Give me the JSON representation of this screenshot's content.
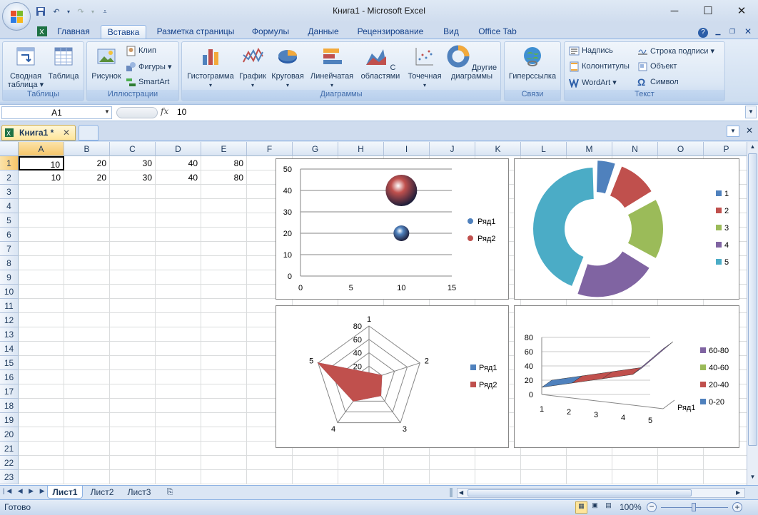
{
  "app": {
    "title": "Книга1 - Microsoft Excel"
  },
  "window_controls": {
    "minimize": "─",
    "maximize": "☐",
    "close": "✕"
  },
  "tabs": [
    "Главная",
    "Вставка",
    "Разметка страницы",
    "Формулы",
    "Данные",
    "Рецензирование",
    "Вид",
    "Office Tab"
  ],
  "active_tab": "Вставка",
  "ribbon": {
    "groups": {
      "tables": "Таблицы",
      "illustrations": "Иллюстрации",
      "charts": "Диаграммы",
      "links": "Связи",
      "text": "Текст"
    },
    "pivot_table": "Сводная таблица ▾",
    "table": "Таблица",
    "picture": "Рисунок",
    "clip": "Клип",
    "shapes": "Фигуры ▾",
    "smartart": "SmartArt",
    "histogram": "Гистограмма",
    "line": "График",
    "pie": "Круговая",
    "bar": "Линейчатая",
    "area": "С областями",
    "scatter": "Точечная",
    "other": "Другие диаграммы",
    "hyperlink": "Гиперссылка",
    "textbox": "Надпись",
    "header_footer": "Колонтитулы",
    "wordart": "WordArt ▾",
    "signature": "Строка подписи ▾",
    "object": "Объект",
    "symbol": "Символ"
  },
  "formula_bar": {
    "name_box": "A1",
    "fx": "fx",
    "content": "10"
  },
  "workbook_tab": {
    "label": "Книга1 *"
  },
  "columns": [
    "A",
    "B",
    "C",
    "D",
    "E",
    "F",
    "G",
    "H",
    "I",
    "J",
    "K",
    "L",
    "M",
    "N",
    "O",
    "P"
  ],
  "rows": [
    "1",
    "2",
    "3",
    "4",
    "5",
    "6",
    "7",
    "8",
    "9",
    "10",
    "11",
    "12",
    "13",
    "14",
    "15",
    "16",
    "17",
    "18",
    "19",
    "20",
    "21",
    "22",
    "23"
  ],
  "cells": {
    "row1": [
      "10",
      "20",
      "30",
      "40",
      "80"
    ],
    "row2": [
      "10",
      "20",
      "30",
      "40",
      "80"
    ]
  },
  "sheets": [
    "Лист1",
    "Лист2",
    "Лист3"
  ],
  "status": {
    "ready": "Готово",
    "zoom": "100%"
  },
  "chart_data": [
    {
      "type": "scatter",
      "subtype": "bubble",
      "series": [
        {
          "name": "Ряд1",
          "x": [
            10
          ],
          "y": [
            20
          ],
          "color": "#4f81bd"
        },
        {
          "name": "Ряд2",
          "x": [
            10
          ],
          "y": [
            40
          ],
          "color": "#c0504d"
        }
      ],
      "xlim": [
        0,
        15
      ],
      "ylim": [
        0,
        50
      ],
      "xticks": [
        "0",
        "5",
        "10",
        "15"
      ],
      "yticks": [
        "0",
        "10",
        "20",
        "30",
        "40",
        "50"
      ],
      "legend": "right"
    },
    {
      "type": "pie",
      "subtype": "doughnut-exploded",
      "categories": [
        "1",
        "2",
        "3",
        "4",
        "5"
      ],
      "values": [
        10,
        20,
        30,
        40,
        80
      ],
      "colors": [
        "#4f81bd",
        "#c0504d",
        "#9bbb59",
        "#8064a2",
        "#4bacc6"
      ],
      "legend": "right"
    },
    {
      "type": "radar",
      "categories": [
        "1",
        "2",
        "3",
        "4",
        "5"
      ],
      "series": [
        {
          "name": "Ряд1",
          "values": [
            10,
            20,
            30,
            40,
            80
          ],
          "color": "#4f81bd"
        },
        {
          "name": "Ряд2",
          "values": [
            10,
            20,
            30,
            40,
            80
          ],
          "color": "#c0504d"
        }
      ],
      "ticks": [
        "0",
        "20",
        "40",
        "60",
        "80"
      ],
      "legend": "right"
    },
    {
      "type": "area",
      "subtype": "3d-surface",
      "categories": [
        "1",
        "2",
        "3",
        "4",
        "5"
      ],
      "series": [
        {
          "name": "Ряд1",
          "values": [
            10,
            20,
            30,
            40,
            80
          ]
        }
      ],
      "zticks": [
        "0",
        "20",
        "40",
        "60",
        "80"
      ],
      "legend_bands": [
        {
          "label": "60-80",
          "color": "#8064a2"
        },
        {
          "label": "40-60",
          "color": "#9bbb59"
        },
        {
          "label": "20-40",
          "color": "#c0504d"
        },
        {
          "label": "0-20",
          "color": "#4f81bd"
        }
      ],
      "legend": "right"
    }
  ]
}
